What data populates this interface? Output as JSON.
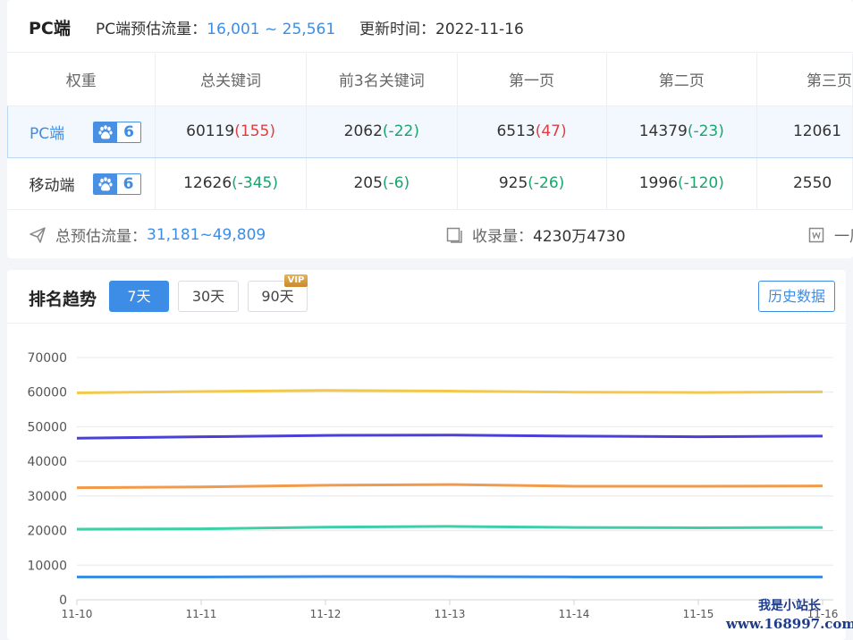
{
  "header": {
    "title": "PC端",
    "flow_label": "PC端预估流量：",
    "flow_value": "16,001 ~ 25,561",
    "update_label": "更新时间：",
    "update_value": "2022-11-16"
  },
  "table": {
    "columns": [
      "权重",
      "总关键词",
      "前3名关键词",
      "第一页",
      "第二页",
      "第三页"
    ],
    "rows": [
      {
        "name": "PC端",
        "badge": "6",
        "cells": [
          {
            "val": "60119",
            "chg": "(155)",
            "dir": "up"
          },
          {
            "val": "2062",
            "chg": "(-22)",
            "dir": "dn"
          },
          {
            "val": "6513",
            "chg": "(47)",
            "dir": "up"
          },
          {
            "val": "14379",
            "chg": "(-23)",
            "dir": "dn"
          },
          {
            "val": "12061",
            "chg": "",
            "dir": "dn"
          }
        ]
      },
      {
        "name": "移动端",
        "badge": "6",
        "cells": [
          {
            "val": "12626",
            "chg": "(-345)",
            "dir": "dn"
          },
          {
            "val": "205",
            "chg": "(-6)",
            "dir": "dn"
          },
          {
            "val": "925",
            "chg": "(-26)",
            "dir": "dn"
          },
          {
            "val": "1996",
            "chg": "(-120)",
            "dir": "dn"
          },
          {
            "val": "2550",
            "chg": "",
            "dir": "dn"
          }
        ]
      }
    ]
  },
  "stats": {
    "total_label": "总预估流量：",
    "total_value": "31,181~49,809",
    "index_label": "收录量：",
    "index_value": "4230万4730",
    "third_label": "一周"
  },
  "trend": {
    "title": "排名趋势",
    "ranges": [
      "7天",
      "30天",
      "90天"
    ],
    "active": "7天",
    "vip_label": "VIP",
    "history_button": "历史数据"
  },
  "colors": {
    "accent": "#3d8de6",
    "up": "#e03e3e",
    "down": "#1aa56d"
  },
  "chart_data": {
    "type": "line",
    "x": [
      "11-10",
      "11-11",
      "11-12",
      "11-13",
      "11-14",
      "11-15",
      "11-16"
    ],
    "ylim": [
      0,
      70000
    ],
    "yticks": [
      0,
      10000,
      20000,
      30000,
      40000,
      50000,
      60000,
      70000
    ],
    "grid": true,
    "series": [
      {
        "color": "#f2c94c",
        "values": [
          59800,
          60200,
          60500,
          60300,
          60000,
          59900,
          60100
        ]
      },
      {
        "color": "#4a3fd6",
        "values": [
          46700,
          47100,
          47500,
          47600,
          47300,
          47100,
          47300
        ]
      },
      {
        "color": "#f2994a",
        "values": [
          32400,
          32600,
          33100,
          33300,
          32800,
          32800,
          32900
        ]
      },
      {
        "color": "#3ecfaa",
        "values": [
          20400,
          20500,
          21000,
          21200,
          20900,
          20800,
          20900
        ]
      },
      {
        "color": "#3d8de6",
        "values": [
          6600,
          6600,
          6700,
          6700,
          6600,
          6600,
          6600
        ]
      }
    ]
  },
  "watermark": {
    "line1": "我是小站长",
    "line2": "www.168997.com"
  }
}
